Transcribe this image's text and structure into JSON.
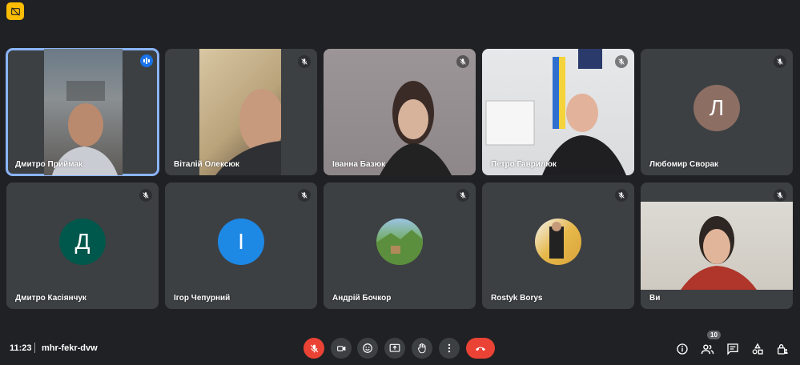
{
  "participants": [
    {
      "name": "Дмитро Приймак",
      "speaking": true
    },
    {
      "name": "Віталій Олексюк",
      "muted": true
    },
    {
      "name": "Іванна Базюк",
      "muted": true
    },
    {
      "name": "Петро Гаврилюк",
      "muted": true
    },
    {
      "name": "Любомир Сворак",
      "initial": "Л",
      "muted": true
    },
    {
      "name": "Дмитро Касіянчук",
      "initial": "Д",
      "muted": true
    },
    {
      "name": "Ігор Чепурний",
      "initial": "І",
      "muted": true
    },
    {
      "name": "Андрій Бочкор",
      "muted": true
    },
    {
      "name": "Rostyk Borys",
      "muted": true
    },
    {
      "name": "Ви",
      "muted": true
    }
  ],
  "meeting": {
    "time": "11:23",
    "code": "mhr-fekr-dvw"
  },
  "people_count": "10",
  "colors": {
    "background": "#202124",
    "tile": "#3c4043",
    "active_outline": "#8ab4f8",
    "end_call": "#ea4335"
  }
}
